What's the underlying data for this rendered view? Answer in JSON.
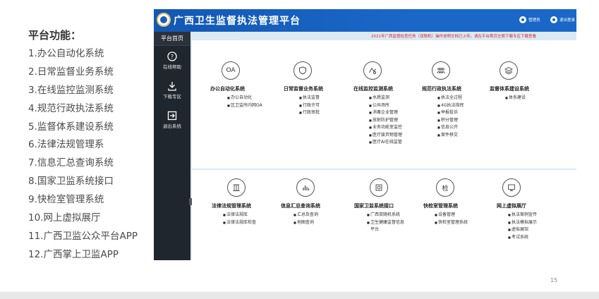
{
  "slide": {
    "features_title": "平台功能：",
    "features": [
      "1.办公自动化系统",
      "2.日常监督业务系统",
      "3.在线监控监测系统",
      "4.规范行政执法系统",
      "5.监督体系建设系统",
      "6.法律法规管理系",
      "7.信息汇总查询系统",
      "8.国家卫监系统接口",
      "9.快检室管理系统",
      "10.网上虚拟展厅",
      "11.广西卫监公众平台APP",
      "12.广西掌上卫监APP"
    ],
    "page_number": "15"
  },
  "app": {
    "title": "广西卫生监督执法管理平台",
    "header": {
      "user_label": "管理员",
      "exit_label": "退出登录"
    },
    "sidebar": {
      "home": "平台首页",
      "items": [
        {
          "label": "在线帮助",
          "icon": "help-circle-icon"
        },
        {
          "label": "下载专区",
          "icon": "download-icon"
        },
        {
          "label": "退出系统",
          "icon": "logout-icon"
        }
      ]
    },
    "notice": "2021年广西监督检查任务（双随机）操作说明文档已上传，请在平台首页左侧下载专区下载查看",
    "modules_top": [
      {
        "icon_text": "OA",
        "title": "办公自动化系统",
        "items": [
          "办公自动化",
          "区卫监所内网OA"
        ]
      },
      {
        "icon_text": "",
        "icon": "shield-icon",
        "title": "日常监督业务系统",
        "items": [
          "执法监督",
          "行政许可",
          "行政审批"
        ]
      },
      {
        "icon_text": "",
        "icon": "monitor-eye-icon",
        "title": "在线监控监测系统",
        "items": [
          "水质监测",
          "公共场所",
          "消毒企业管理",
          "放射防护管理",
          "业务功能室监控",
          "医疗废弃物管理",
          "医疗AI在线监管"
        ]
      },
      {
        "icon_text": "",
        "icon": "people-icon",
        "title": "规范行政执法系统",
        "items": [
          "执法全过程",
          "4G执法指挥",
          "举报投诉",
          "积分管理",
          "信息公开",
          "案件移交"
        ]
      },
      {
        "icon_text": "",
        "icon": "layers-icon",
        "title": "监督体系建设系统",
        "items": [
          "体系建设"
        ]
      }
    ],
    "modules_bottom": [
      {
        "icon_text": "",
        "icon": "law-icon",
        "title": "法律法规管理系统",
        "items": [
          "法律法规库",
          "法律法规库检查"
        ]
      },
      {
        "icon_text": "",
        "icon": "chart-icon",
        "title": "信息汇总查询系统",
        "items": [
          "汇总及查询",
          "地图查询"
        ]
      },
      {
        "icon_text": "",
        "icon": "interface-icon",
        "title": "国家卫监系统接口",
        "items": [
          "广西双随机系统",
          "卫生健康监督信息平台"
        ]
      },
      {
        "icon_text": "检",
        "title": "快检室管理系统",
        "items": [
          "设备管理",
          "快检室管理系统"
        ]
      },
      {
        "icon_text": "",
        "icon": "screen-icon",
        "title": "网上虚拟展厅",
        "items": [
          "执法案例宣传",
          "执法模拟展示",
          "虚拟展馆",
          "考试系统"
        ]
      }
    ]
  }
}
